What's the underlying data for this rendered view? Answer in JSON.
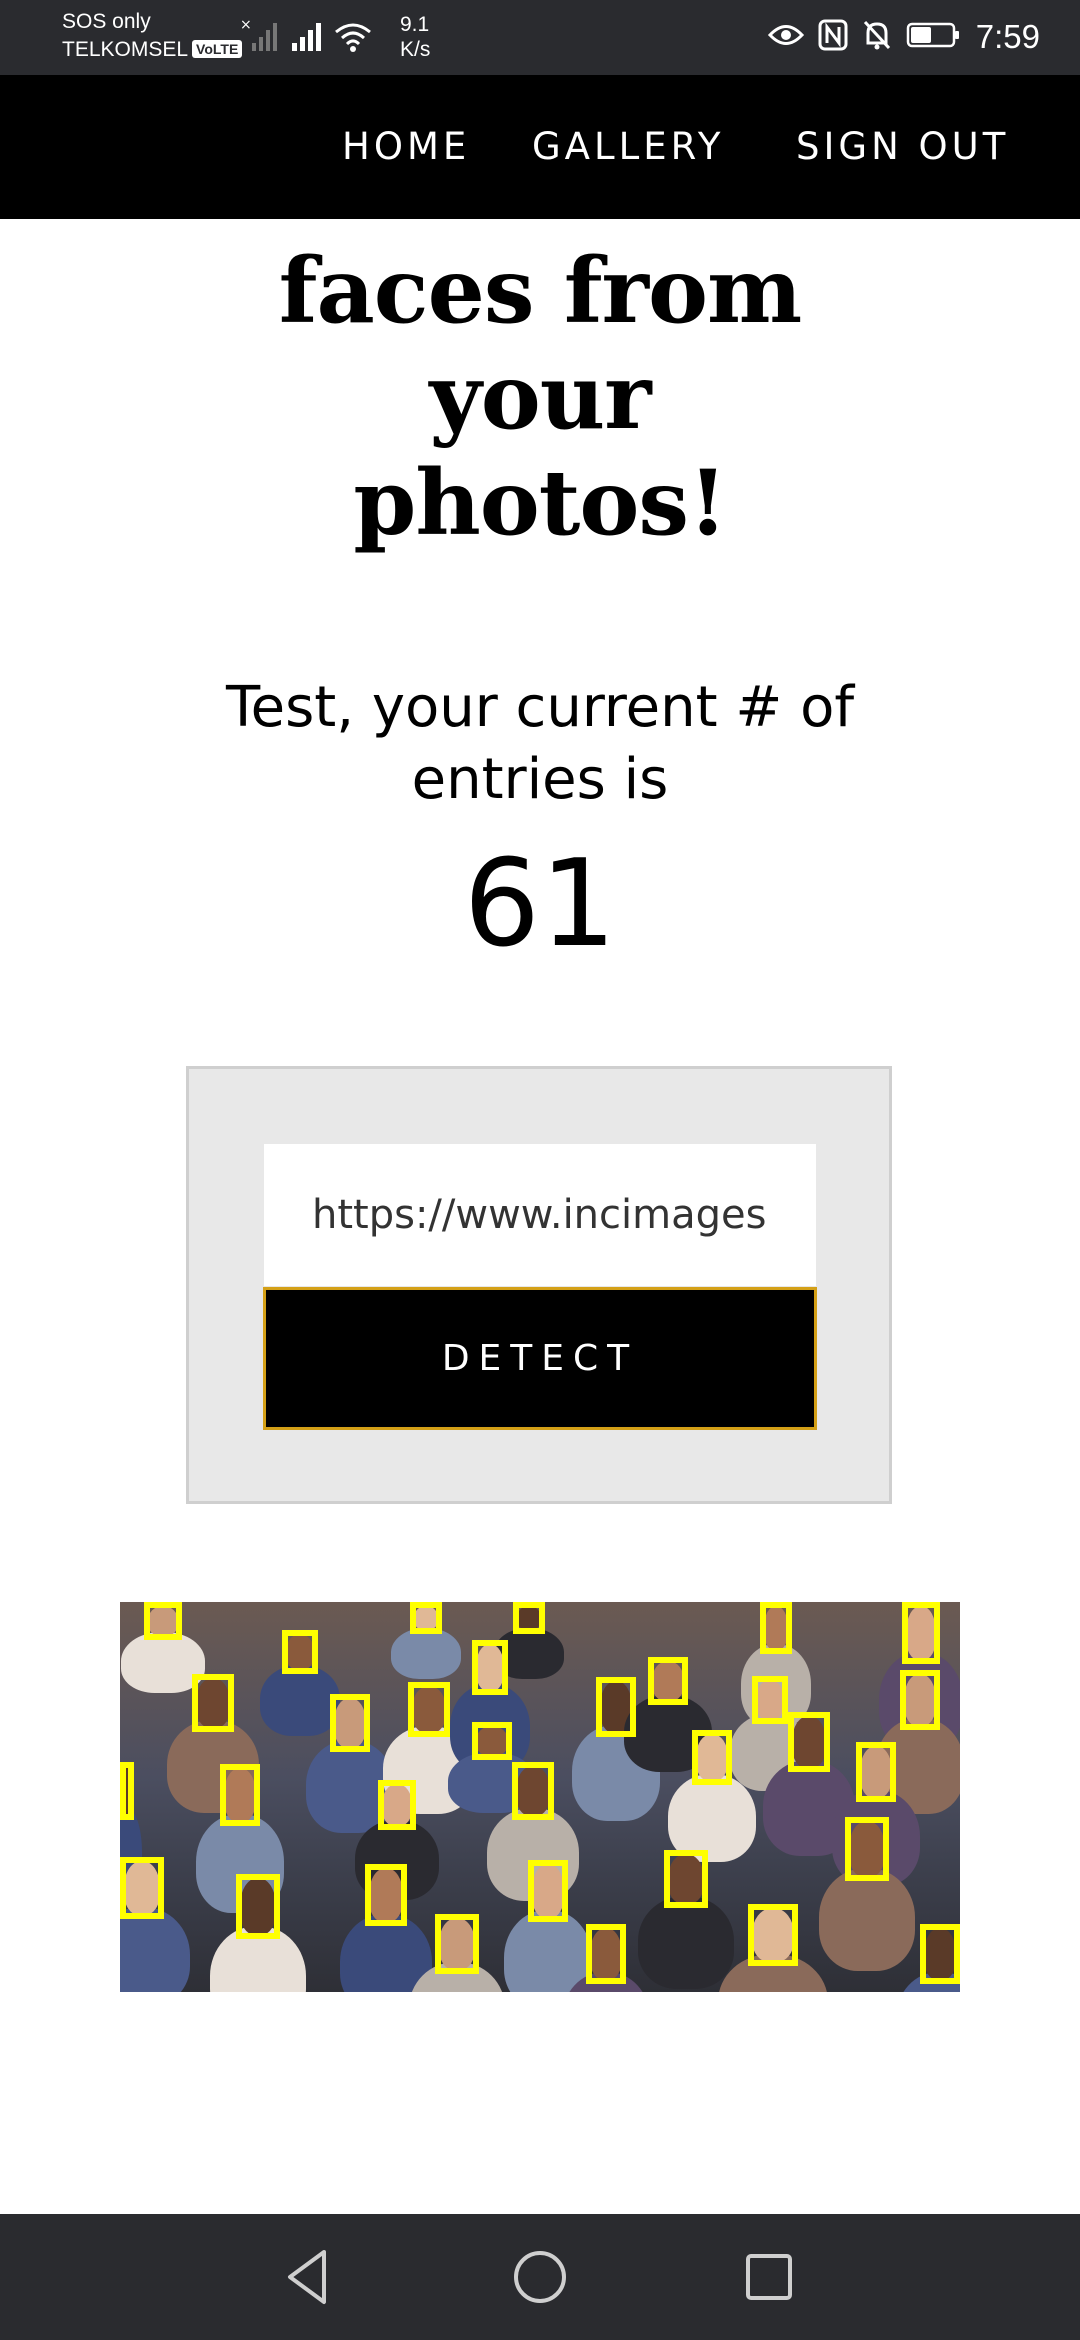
{
  "status_bar": {
    "line1": "SOS only",
    "carrier": "TELKOMSEL",
    "volte": "VoLTE",
    "speed_value": "9.1",
    "speed_unit": "K/s",
    "time": "7:59",
    "icons": [
      "no-signal-icon",
      "signal-icon",
      "wifi-icon",
      "eye-icon",
      "nfc-icon",
      "bell-off-icon",
      "battery-icon"
    ]
  },
  "nav": {
    "home": "HOME",
    "gallery": "GALLERY",
    "signout": "SIGN OUT"
  },
  "title": {
    "line1": "faces from",
    "line2": "your",
    "line3": "photos!"
  },
  "greeting": {
    "line1": "Test, your current # of",
    "line2": "entries is"
  },
  "entries_count": "61",
  "form": {
    "url_value": "https://www.incimages",
    "detect_label": "DETECT"
  },
  "colors": {
    "nav_bg": "#000000",
    "status_bg": "#2a2b2f",
    "panel_bg": "#e8e8e8",
    "face_box": "#ffff00",
    "button_border": "#d4a017"
  },
  "system_nav": [
    "back-icon",
    "home-icon",
    "recents-icon"
  ]
}
